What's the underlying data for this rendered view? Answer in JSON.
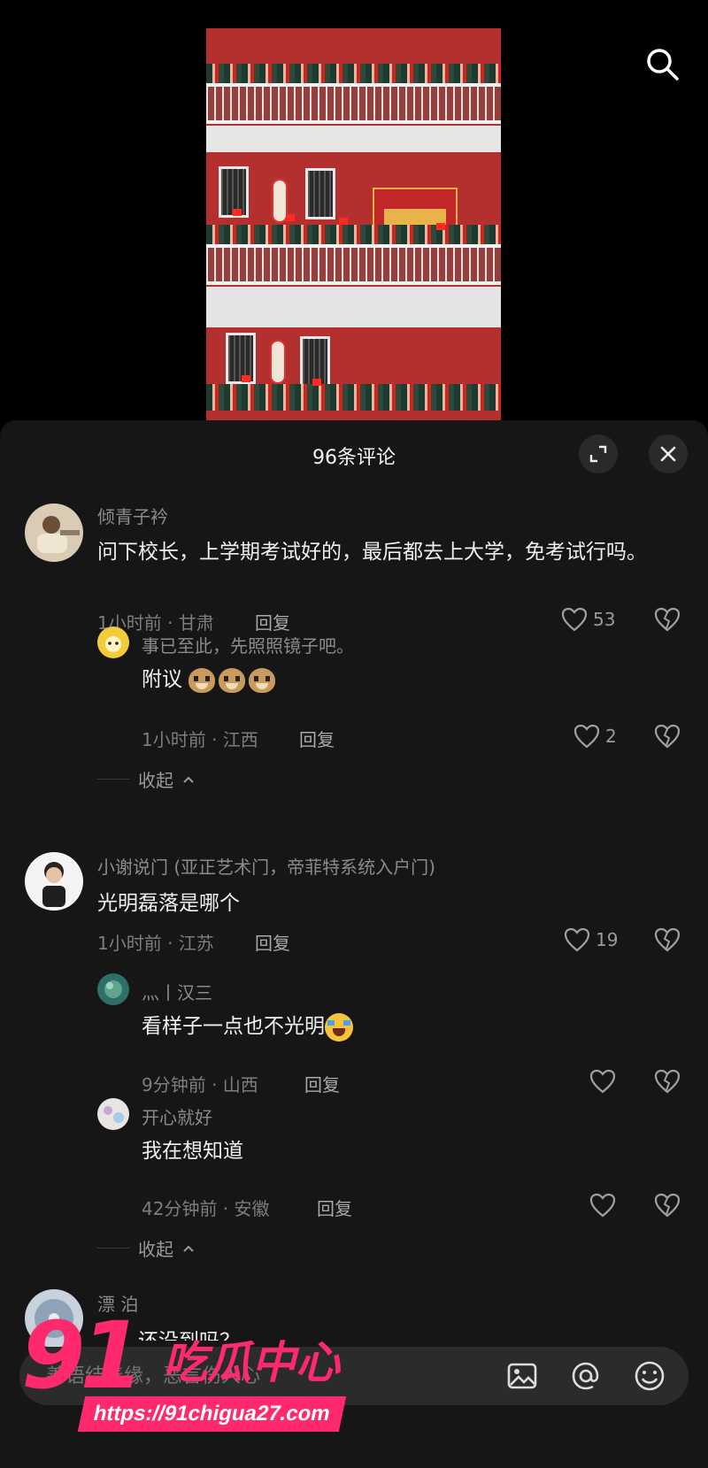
{
  "sheet": {
    "title": "96条评论"
  },
  "comments": [
    {
      "user": "倾青子衿",
      "text": "问下校长，上学期考试好的，最后都去上大学，免考试行吗。",
      "time_location": "1小时前 · 甘肃",
      "reply_label": "回复",
      "likes": "53",
      "replies": [
        {
          "user": "事已至此，先照照镜子吧。",
          "text": "附议",
          "emoji": "dog-emoji",
          "time_location": "1小时前 · 江西",
          "reply_label": "回复",
          "likes": "2"
        }
      ],
      "collapse_label": "收起"
    },
    {
      "user": "小谢说门 (亚正艺术门，帝菲特系统入户门)",
      "text": "光明磊落是哪个",
      "time_location": "1小时前 · 江苏",
      "reply_label": "回复",
      "likes": "19",
      "replies": [
        {
          "user": "灬丨汉三",
          "text": "看样子一点也不光明",
          "emoji": "crying-laughing-emoji",
          "time_location": "9分钟前 · 山西",
          "reply_label": "回复",
          "likes": ""
        },
        {
          "user": "开心就好",
          "text": "我在想知道",
          "time_location": "42分钟前 · 安徽",
          "reply_label": "回复",
          "likes": ""
        }
      ],
      "collapse_label": "收起"
    },
    {
      "user": "漂 泊",
      "text": "……还没到吗？"
    }
  ],
  "input": {
    "placeholder": "善语结善缘，恶言伤人心"
  },
  "watermark": {
    "number": "91",
    "name": "吃瓜中心",
    "url": "https://91chigua27.com"
  },
  "colors": {
    "sheet_bg": "#161616",
    "watermark": "#ff2a6d"
  }
}
